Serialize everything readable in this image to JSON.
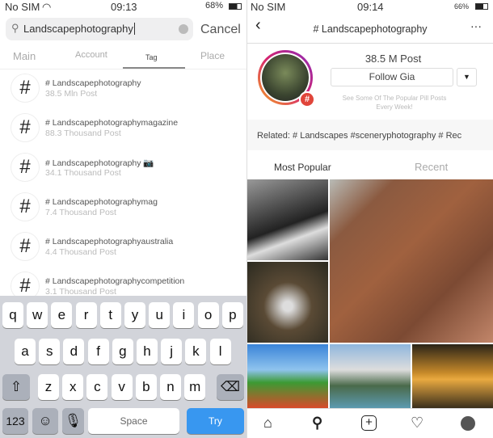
{
  "left": {
    "status": {
      "carrier": "No SIM",
      "time": "09:13",
      "battery": "68%"
    },
    "search": {
      "value": "Landscapephotography",
      "cancel": "Cancel"
    },
    "tabs": [
      "Main",
      "Account",
      "Tag",
      "Place"
    ],
    "results": [
      {
        "name": "# Landscapephotography",
        "posts": "38.5 Mln Post"
      },
      {
        "name": "# Landscapephotographymagazine",
        "posts": "88.3 Thousand Post"
      },
      {
        "name": "# Landscapephotography 📷",
        "posts": "34.1 Thousand Post"
      },
      {
        "name": "# Landscapephotographymag",
        "posts": "7.4 Thousand Post"
      },
      {
        "name": "# Landscapephotographyaustralia",
        "posts": "4.4 Thousand Post"
      },
      {
        "name": "# Landscapephotographycompetition",
        "posts": "3.1 Thousand Post"
      }
    ],
    "keyboard": {
      "row1": [
        "q",
        "w",
        "e",
        "r",
        "t",
        "y",
        "u",
        "i",
        "o",
        "p"
      ],
      "row2": [
        "a",
        "s",
        "d",
        "f",
        "g",
        "h",
        "j",
        "k",
        "l"
      ],
      "row3": [
        "z",
        "x",
        "c",
        "v",
        "b",
        "n",
        "m"
      ],
      "numbers": "123",
      "space": "Space",
      "go": "Try"
    }
  },
  "right": {
    "status": {
      "carrier": "No SIM",
      "time": "09:14",
      "battery": "66%"
    },
    "title": "# Landscapephotography",
    "posts": "38.5 M Post",
    "follow": "Follow Gia",
    "hint": "See Some Of The Popular Pill Posts Every Week!",
    "related": "Related: # Landscapes #sceneryphotography # Rec",
    "tabs": [
      "Most Popular",
      "Recent"
    ],
    "accent": "#3897f0"
  }
}
